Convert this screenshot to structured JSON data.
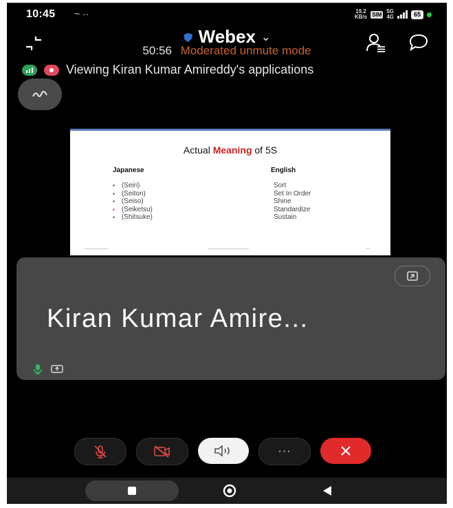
{
  "status_bar": {
    "time": "10:45",
    "notification_icons": "~ ··",
    "speed_value": "19.2",
    "speed_unit": "KB/s",
    "sim_badge": "SIM",
    "network_value": "5G",
    "network_sub": "4G",
    "battery": "65"
  },
  "header": {
    "app_title": "Webex",
    "timer": "50:56",
    "mode": "Moderated unmute mode"
  },
  "sharing": {
    "text": "Viewing Kiran Kumar Amireddy's applications"
  },
  "slide": {
    "title_before": "Actual ",
    "title_highlight": "Meaning",
    "title_after": " of 5S",
    "col_japanese": "Japanese",
    "col_english": "English",
    "japanese": [
      "(Seiri)",
      "(Seiton)",
      "(Seiso)",
      "(Seiketsu)",
      "(Shitsuke)"
    ],
    "english": [
      "Sort",
      "Set In Order",
      "Shine",
      "Standardize",
      "Sustain"
    ]
  },
  "participant": {
    "name": "Kiran Kumar Amire..."
  },
  "controls": {
    "more_label": "···"
  },
  "colors": {
    "accent_red": "#e12a2a",
    "mode_orange": "#c9622a",
    "highlight_red": "#cc1f1f"
  }
}
